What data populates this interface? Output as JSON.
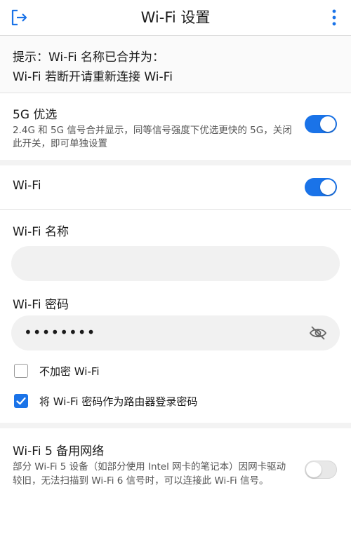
{
  "header": {
    "title": "Wi-Fi 设置",
    "exit_icon": "exit-icon",
    "more_icon": "more-vertical-icon"
  },
  "notice": {
    "line1": "提示：Wi-Fi 名称已合并为：",
    "line2": "Wi-Fi 若断开请重新连接 Wi-Fi"
  },
  "band_steering": {
    "label": "5G 优选",
    "description": "2.4G 和 5G 信号合并显示，同等信号强度下优选更快的 5G，关闭此开关，即可单独设置",
    "enabled": true
  },
  "wifi": {
    "label": "Wi-Fi",
    "enabled": true
  },
  "form": {
    "name_label": "Wi-Fi 名称",
    "name_value": "",
    "password_label": "Wi-Fi 密码",
    "password_value": "••••••••",
    "eye_icon": "eye-off-icon",
    "no_encrypt_label": "不加密 Wi-Fi",
    "no_encrypt_checked": false,
    "use_as_admin_label": "将 Wi-Fi 密码作为路由器登录密码",
    "use_as_admin_checked": true
  },
  "wifi5": {
    "label": "Wi-Fi 5 备用网络",
    "description": "部分 Wi-Fi 5 设备（如部分使用 Intel 网卡的笔记本）因网卡驱动较旧，无法扫描到 Wi-Fi 6 信号时，可以连接此 Wi-Fi 信号。",
    "enabled": false
  },
  "colors": {
    "accent": "#1a73e8",
    "background": "#ffffff",
    "section_gap": "#f3f3f3"
  }
}
